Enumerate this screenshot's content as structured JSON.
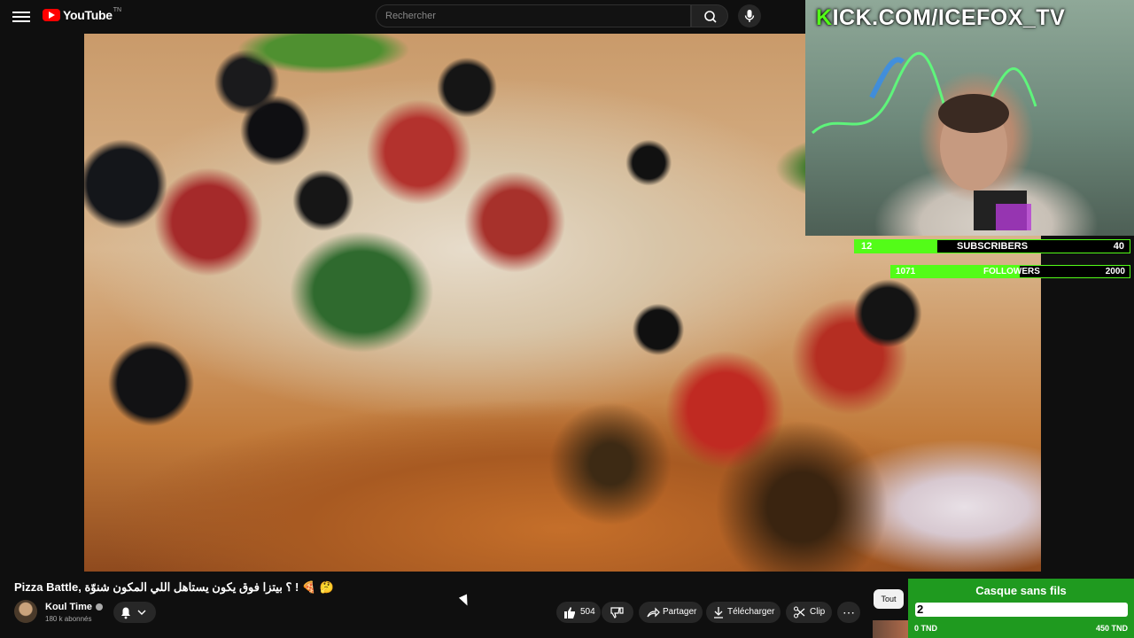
{
  "header": {
    "logo_text": "YouTube",
    "logo_sup": "TN",
    "search_placeholder": "Rechercher"
  },
  "overlay": {
    "kick_prefix": "K",
    "kick_rest": "ICK.COM/ICEFOX_TV",
    "subscribers": {
      "current": "12",
      "label": "SUBSCRIBERS",
      "goal": "40",
      "progress": 0.3
    },
    "followers": {
      "current": "1071",
      "label": "FOLLOWERS",
      "goal": "2000",
      "progress": 0.54
    }
  },
  "video_info": {
    "title": "Pizza Battle, ؟ بيتزا فوق يكون يستاهل اللي المكون شنوّة ! 🍕 🤔",
    "channel_name": "Koul Time",
    "subscribers": "180 k abonnés",
    "likes": "504",
    "share_label": "Partager",
    "download_label": "Télécharger",
    "clip_label": "Clip",
    "more_label": "⋯"
  },
  "sidebar": {
    "filter_chip": "Tout"
  },
  "donation": {
    "item": "Casque sans fils",
    "current_display": "2",
    "min_label": "0 TND",
    "max_label": "450 TND"
  },
  "colors": {
    "kick_green": "#53fc18",
    "youtube_red": "#ff0000",
    "donation_green": "#1f9a1f"
  }
}
